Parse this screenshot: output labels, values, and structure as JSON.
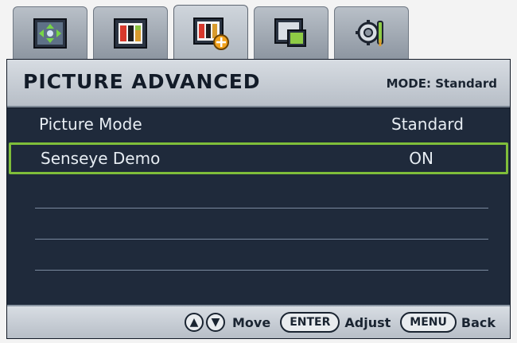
{
  "tabs": [
    {
      "icon": "display-adjust-icon",
      "active": false
    },
    {
      "icon": "picture-color-icon",
      "active": false
    },
    {
      "icon": "picture-advanced-icon",
      "active": true
    },
    {
      "icon": "pip-window-icon",
      "active": false
    },
    {
      "icon": "system-settings-icon",
      "active": false
    }
  ],
  "header": {
    "title": "PICTURE ADVANCED",
    "mode": "MODE: Standard"
  },
  "menu": [
    {
      "label": "Picture Mode",
      "value": "Standard",
      "selected": false
    },
    {
      "label": "Senseye Demo",
      "value": "ON",
      "selected": true
    }
  ],
  "footer": {
    "move_label": "Move",
    "enter_key": "ENTER",
    "adjust_label": "Adjust",
    "menu_key": "MENU",
    "back_label": "Back"
  },
  "colors": {
    "panel_background": "#1f2a3b",
    "selection_border": "#7fbe3a",
    "header_background": "#c8ced5"
  }
}
